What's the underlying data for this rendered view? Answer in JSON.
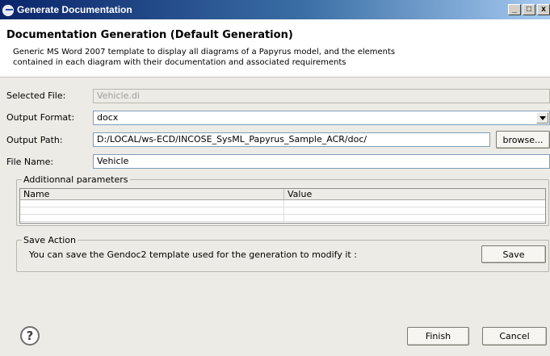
{
  "window": {
    "title": "Generate Documentation"
  },
  "header": {
    "title": "Documentation Generation (Default Generation)",
    "description_line1": "Generic MS Word 2007 template to display all diagrams of a Papyrus model, and the elements",
    "description_line2": "contained in each diagram with their documentation and associated requirements"
  },
  "form": {
    "selected_file_label": "Selected File:",
    "selected_file_value": "Vehicle.di",
    "output_format_label": "Output Format:",
    "output_format_value": "docx",
    "output_path_label": "Output Path:",
    "output_path_value": "D:/LOCAL/ws-ECD/INCOSE_SysML_Papyrus_Sample_ACR/doc/",
    "browse_label": "browse...",
    "file_name_label": "File Name:",
    "file_name_value": "Vehicle"
  },
  "params": {
    "legend": "Additionnal parameters",
    "columns": [
      "Name",
      "Value"
    ],
    "rows": [
      [
        "",
        ""
      ],
      [
        "",
        ""
      ],
      [
        "",
        ""
      ]
    ]
  },
  "save_action": {
    "legend": "Save Action",
    "text": "You can save the Gendoc2 template used for the generation to modify it :",
    "button": "Save"
  },
  "footer": {
    "help_glyph": "?",
    "finish": "Finish",
    "cancel": "Cancel"
  }
}
